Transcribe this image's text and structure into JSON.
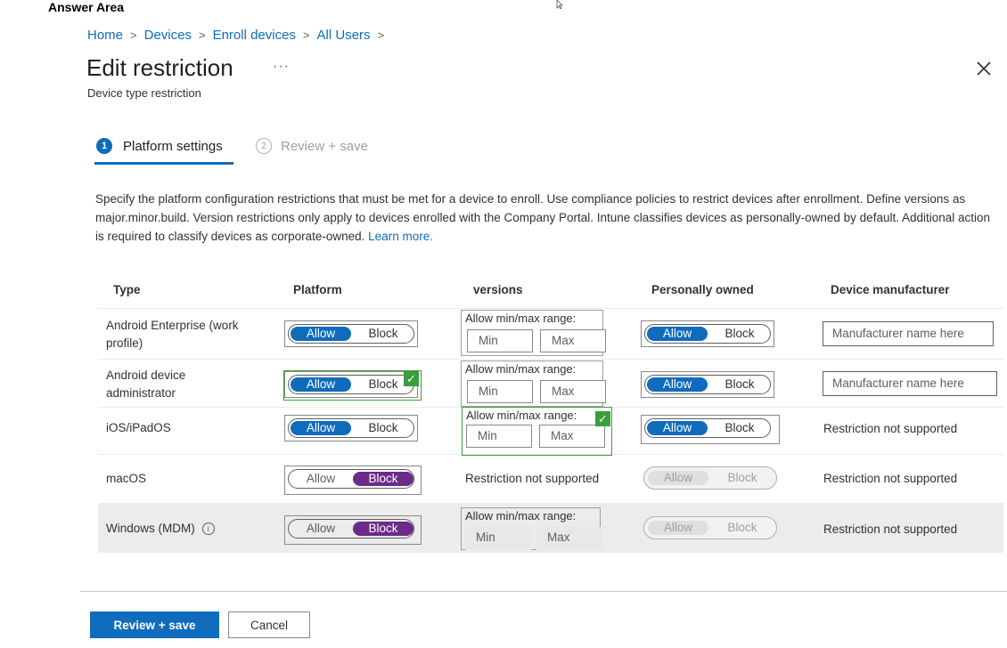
{
  "answer_area": "Answer Area",
  "breadcrumb": [
    "Home",
    "Devices",
    "Enroll devices",
    "All Users"
  ],
  "title": "Edit restriction",
  "more": "···",
  "subtitle": "Device type restriction",
  "steps": [
    {
      "num": "1",
      "label": "Platform settings"
    },
    {
      "num": "2",
      "label": "Review + save"
    }
  ],
  "description": "Specify the platform configuration restrictions that must be met for a device to enroll. Use compliance policies to restrict devices after enrollment. Define versions as major.minor.build. Version restrictions only apply to devices enrolled with the Company Portal. Intune classifies devices as personally-owned by default. Additional action is required to classify devices as corporate-owned.",
  "learn_more": "Learn more.",
  "table": {
    "headers": [
      "Type",
      "Platform",
      "versions",
      "Personally owned",
      "Device manufacturer"
    ],
    "toggle": {
      "allow": "Allow",
      "block": "Block"
    },
    "range": {
      "label": "Allow min/max range:",
      "min": "Min",
      "max": "Max"
    },
    "not_supported": "Restriction not supported",
    "manufacturer_placeholder": "Manufacturer name here",
    "rows": [
      {
        "type": "Android Enterprise (work profile)"
      },
      {
        "type": "Android device administrator"
      },
      {
        "type": "iOS/iPadOS"
      },
      {
        "type": "macOS"
      },
      {
        "type": "Windows (MDM)"
      }
    ]
  },
  "info": "i",
  "checkmark": "✓",
  "footer": {
    "review_save": "Review + save",
    "cancel": "Cancel"
  }
}
